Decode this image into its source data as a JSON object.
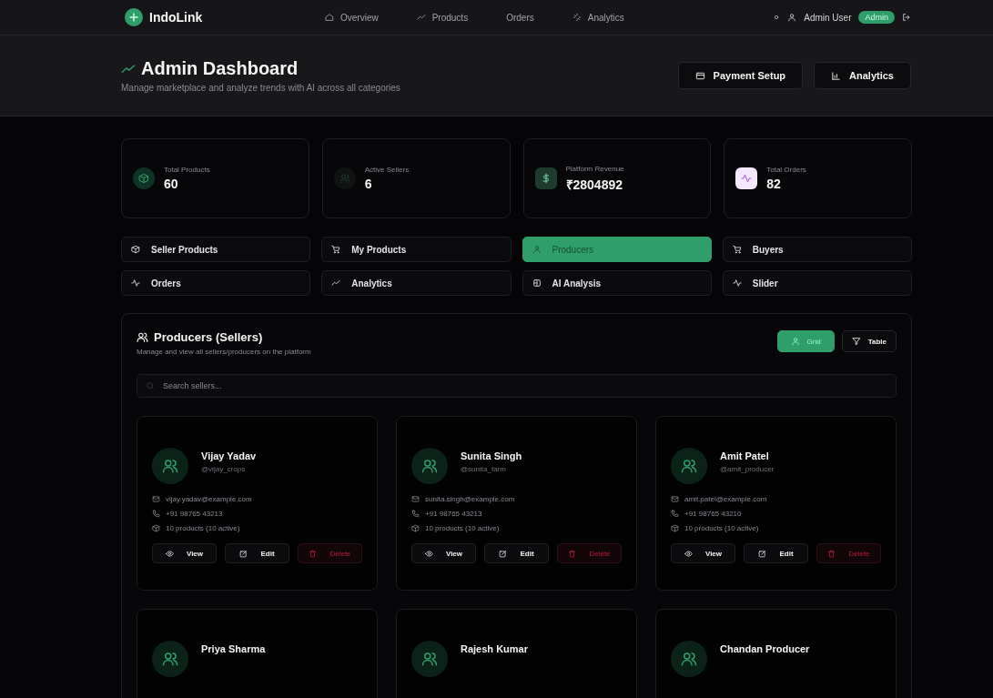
{
  "nav": {
    "brand": "IndoLink",
    "links": [
      {
        "label": "Overview",
        "kind": "home"
      },
      {
        "label": "Products",
        "kind": "trend"
      },
      {
        "label": "Orders",
        "kind": "plain"
      },
      {
        "label": "Analytics",
        "kind": "spark"
      }
    ],
    "user": "Admin User",
    "badge": "Admin"
  },
  "header": {
    "title": "Admin Dashboard",
    "subtitle": "Manage marketplace and analyze trends with AI across all categories",
    "buttons": [
      {
        "label": "Payment Setup",
        "kind": "card"
      },
      {
        "label": "Analytics",
        "kind": "chart"
      }
    ]
  },
  "stats": [
    {
      "label": "Total Products",
      "value": "60",
      "kind": "box"
    },
    {
      "label": "Active Sellers",
      "value": "6",
      "kind": "users"
    },
    {
      "label": "Platform Revenue",
      "value": "₹2804892",
      "kind": "dollar"
    },
    {
      "label": "Total Orders",
      "value": "82",
      "kind": "pulse"
    }
  ],
  "tabs": [
    {
      "label": "Seller Products",
      "kind": "box",
      "selected": false
    },
    {
      "label": "My Products",
      "kind": "cart",
      "selected": false
    },
    {
      "label": "Producers",
      "kind": "user",
      "selected": true
    },
    {
      "label": "Buyers",
      "kind": "cart",
      "selected": false
    },
    {
      "label": "Orders",
      "kind": "pulse",
      "selected": false
    },
    {
      "label": "Analytics",
      "kind": "trend",
      "selected": false
    },
    {
      "label": "AI Analysis",
      "kind": "chip",
      "selected": false
    },
    {
      "label": "Slider",
      "kind": "pulse",
      "selected": false
    }
  ],
  "panel": {
    "title": "Producers (Sellers)",
    "subtitle": "Manage and view all sellers/producers on the platform",
    "views": [
      {
        "label": "Grid",
        "kind": "user",
        "selected": true
      },
      {
        "label": "Table",
        "kind": "filter",
        "selected": false
      }
    ],
    "search": {
      "placeholder": "Search sellers..."
    },
    "sellers": [
      {
        "name": "Vijay Yadav",
        "handle": "@vijay_crops",
        "email": "vijay.yadav@example.com",
        "phone": "+91 98765 43213",
        "products": "10 products (10 active)",
        "actions": [
          "View",
          "Edit",
          "Delete"
        ]
      },
      {
        "name": "Sunita Singh",
        "handle": "@sunita_farm",
        "email": "sunita.singh@example.com",
        "phone": "+91 98765 43213",
        "products": "10 products (10 active)",
        "actions": [
          "View",
          "Edit",
          "Delete"
        ]
      },
      {
        "name": "Amit Patel",
        "handle": "@amit_producer",
        "email": "amit.patel@example.com",
        "phone": "+91 98765 43210",
        "products": "10 products (10 active)",
        "actions": [
          "View",
          "Edit",
          "Delete"
        ]
      },
      {
        "name": "Priya Sharma"
      },
      {
        "name": "Rajesh Kumar"
      },
      {
        "name": "Chandan Producer"
      }
    ]
  }
}
